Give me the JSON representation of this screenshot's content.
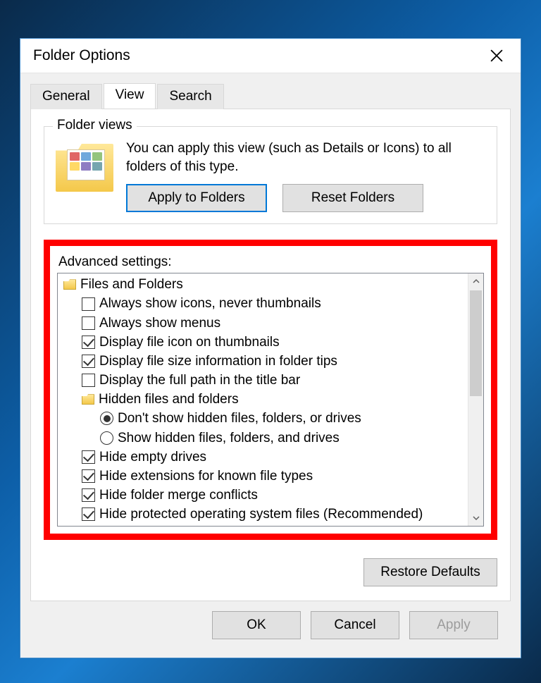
{
  "window": {
    "title": "Folder Options"
  },
  "tabs": {
    "general": "General",
    "view": "View",
    "search": "Search",
    "active": "view"
  },
  "folder_views": {
    "group_title": "Folder views",
    "description": "You can apply this view (such as Details or Icons) to all folders of this type.",
    "apply_btn": "Apply to Folders",
    "reset_btn": "Reset Folders"
  },
  "advanced": {
    "label": "Advanced settings:",
    "root_label": "Files and Folders",
    "items": [
      {
        "kind": "check",
        "checked": false,
        "label": "Always show icons, never thumbnails"
      },
      {
        "kind": "check",
        "checked": false,
        "label": "Always show menus"
      },
      {
        "kind": "check",
        "checked": true,
        "label": "Display file icon on thumbnails"
      },
      {
        "kind": "check",
        "checked": true,
        "label": "Display file size information in folder tips"
      },
      {
        "kind": "check",
        "checked": false,
        "label": "Display the full path in the title bar"
      },
      {
        "kind": "folder",
        "label": "Hidden files and folders"
      },
      {
        "kind": "radio",
        "checked": true,
        "label": "Don't show hidden files, folders, or drives"
      },
      {
        "kind": "radio",
        "checked": false,
        "label": "Show hidden files, folders, and drives"
      },
      {
        "kind": "check",
        "checked": true,
        "label": "Hide empty drives"
      },
      {
        "kind": "check",
        "checked": true,
        "label": "Hide extensions for known file types"
      },
      {
        "kind": "check",
        "checked": true,
        "label": "Hide folder merge conflicts"
      },
      {
        "kind": "check",
        "checked": true,
        "label": "Hide protected operating system files (Recommended)"
      }
    ]
  },
  "buttons": {
    "restore_defaults": "Restore Defaults",
    "ok": "OK",
    "cancel": "Cancel",
    "apply": "Apply"
  }
}
